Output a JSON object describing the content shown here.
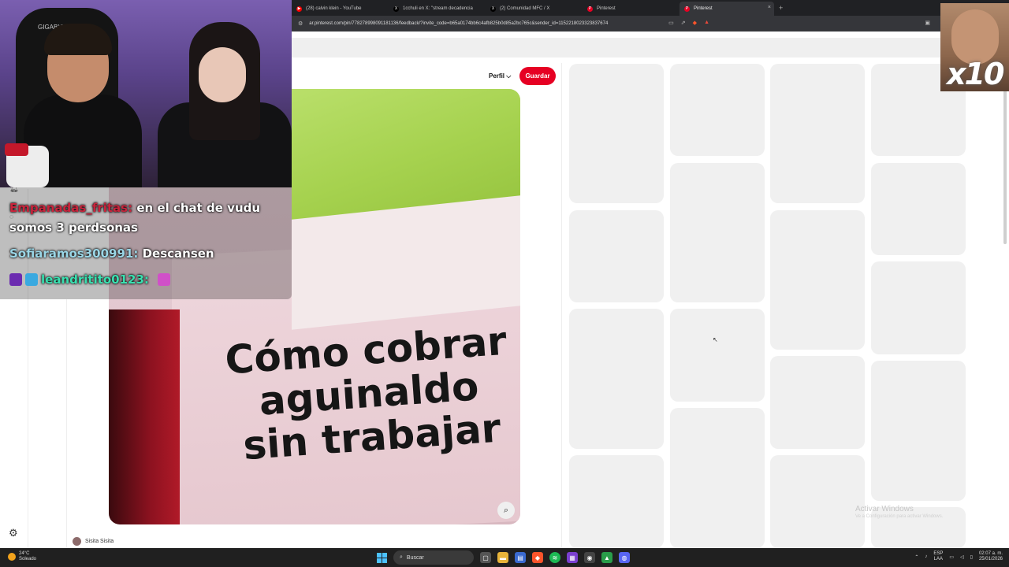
{
  "browser": {
    "tabs": [
      {
        "label": "(28) calvin klein - YouTube",
        "icon": "youtube-icon",
        "color": "#ff0000"
      },
      {
        "label": "1cchuli en X: \"stream decadencia",
        "icon": "x-icon",
        "color": "#000000"
      },
      {
        "label": "(2) Comunidad MFC / X",
        "icon": "x-icon",
        "color": "#000000"
      },
      {
        "label": "Pinterest",
        "icon": "pinterest-icon",
        "color": "#e60023"
      },
      {
        "label": "Pinterest",
        "icon": "pinterest-icon",
        "color": "#e60023",
        "active": true
      }
    ],
    "new_tab": "+",
    "close": "×",
    "url": "ar.pinterest.com/pin/778278998091181136/feedback/?invite_code=b65a0174bb6c4afb825b0d85a2bc765c&sender_id=1152218023323837674"
  },
  "pin": {
    "profile_label": "Perfil",
    "save_label": "Guardar",
    "image_text": [
      "Cómo cobrar",
      "aguinaldo",
      "sin trabajar"
    ],
    "author": "Sisita Sisita",
    "accent": "#e60023"
  },
  "chat": {
    "messages": [
      {
        "user": "Empanadas_fritas:",
        "text": " en el chat de vudu somos 3 perdsonas",
        "color": "#c9243c"
      },
      {
        "user": "Sofiaramos300991:",
        "text": " Descansen",
        "color": "#9ad6e6"
      },
      {
        "user": "leandritito0123:",
        "text": "",
        "color": "#39e0b0"
      }
    ]
  },
  "overlay": {
    "multiplier": "x10",
    "chair_brand": "GIGABYTE"
  },
  "watermark": {
    "title": "Activar Windows",
    "subtitle": "Ve a Configuración para activar Windows."
  },
  "taskbar": {
    "temperature": "24°C",
    "weather": "Soleado",
    "search_label": "Buscar",
    "lang_top": "ESP",
    "lang_bottom": "LAA",
    "time": "02:07 a. m.",
    "date": "25/01/2026"
  }
}
